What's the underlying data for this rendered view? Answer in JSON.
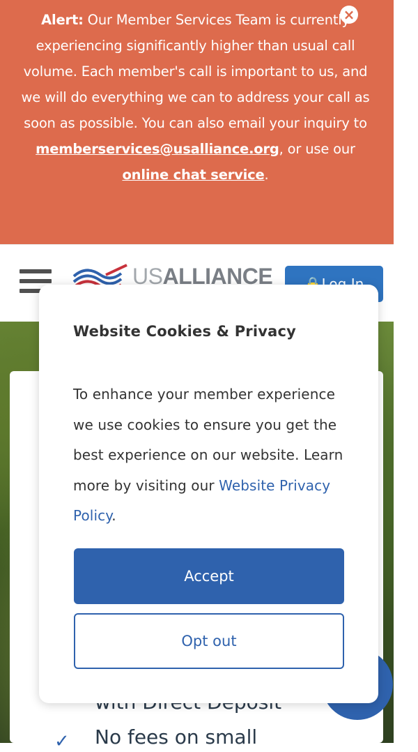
{
  "alert": {
    "label": "Alert:",
    "message_part1": " Our Member Services Team is currently experiencing significantly higher than usual call volume. Each member's call is important to us, and we will do everything we can to address your call as soon as possible. You can also email your inquiry to ",
    "email_link": "memberservices@usalliance.org",
    "message_part2": ", or use our ",
    "chat_link": "online chat service",
    "message_end": "."
  },
  "header": {
    "logo_us": "US",
    "logo_alliance": "ALLIANCE",
    "login_label": "Log In"
  },
  "background": {
    "hero_item": "with Direct Deposit",
    "hero_item_2": "No fees on small"
  },
  "cookie_modal": {
    "title": "Website Cookies & Privacy",
    "body": "To enhance your member experience we use cookies to ensure you get the best experience on our website. Learn more by visiting our ",
    "policy_link": "Website Privacy Policy",
    "body_end": ".",
    "accept_label": "Accept",
    "optout_label": "Opt out"
  },
  "colors": {
    "alert_bg": "#dd6b4d",
    "primary": "#2f62ad",
    "login_bg": "#2f74c0"
  }
}
